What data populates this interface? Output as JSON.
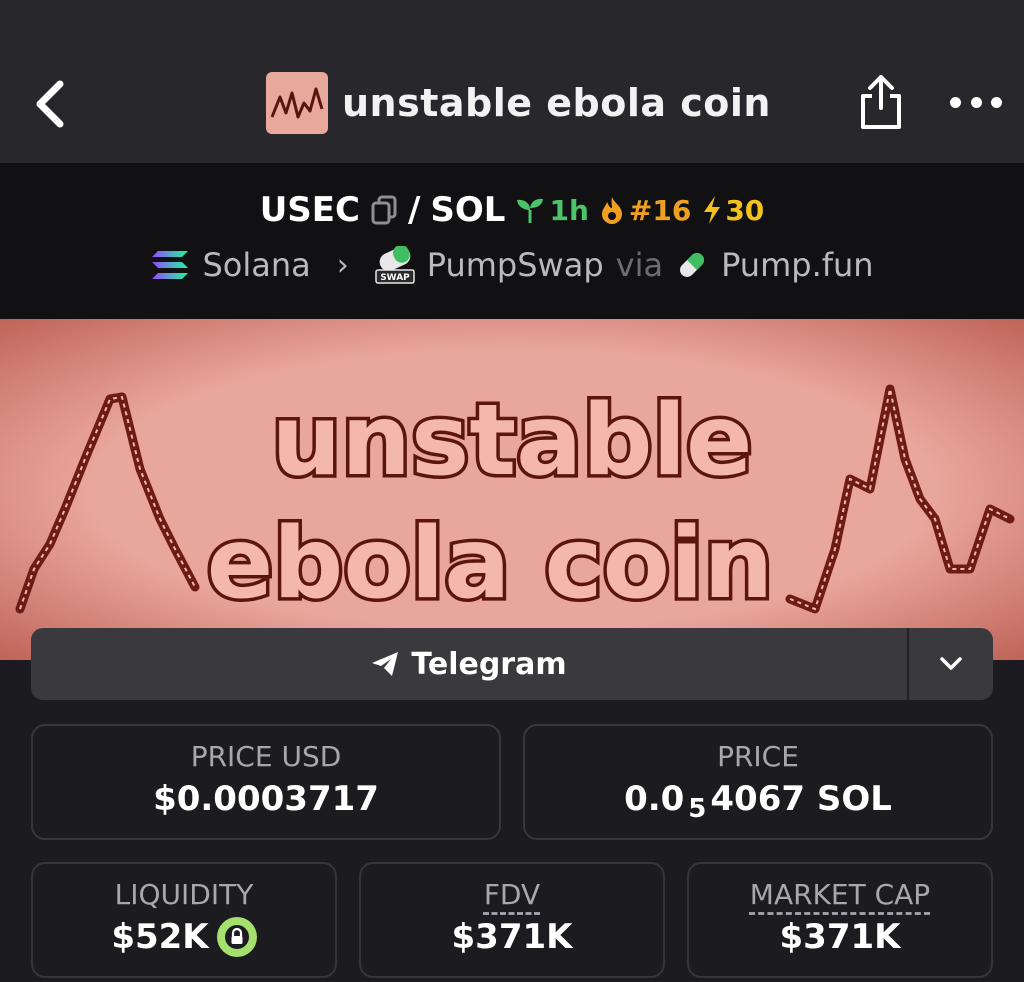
{
  "header": {
    "title": "unstable ebola coin",
    "back_icon": "chevron-left-icon",
    "share_icon": "share-icon",
    "more_icon": "more-horizontal-icon"
  },
  "pair": {
    "base": "USEC",
    "separator": "/",
    "quote": "SOL",
    "age": "1h",
    "rank": "#16",
    "boosts": "30"
  },
  "chain": {
    "network": "Solana",
    "dex": "PumpSwap",
    "via": "via",
    "launchpad": "Pump.fun",
    "dex_badge": "SWAP"
  },
  "banner": {
    "line1": "unstable",
    "line2": "ebola coin"
  },
  "social": {
    "telegram_label": "Telegram"
  },
  "stats": {
    "price_usd_label": "PRICE USD",
    "price_usd_value": "$0.0003717",
    "price_label": "PRICE",
    "price_prefix": "0.0",
    "price_zeros": "5",
    "price_digits": "4067 SOL",
    "liquidity_label": "LIQUIDITY",
    "liquidity_value": "$52K",
    "fdv_label": "FDV",
    "fdv_value": "$371K",
    "mcap_label": "MARKET CAP",
    "mcap_value": "$371K"
  },
  "colors": {
    "accent_green": "#4cc46a",
    "accent_orange": "#f0a020",
    "accent_yellow": "#f2c21b",
    "banner_pink": "#e7a39a",
    "lock_green": "#a6e06c"
  }
}
